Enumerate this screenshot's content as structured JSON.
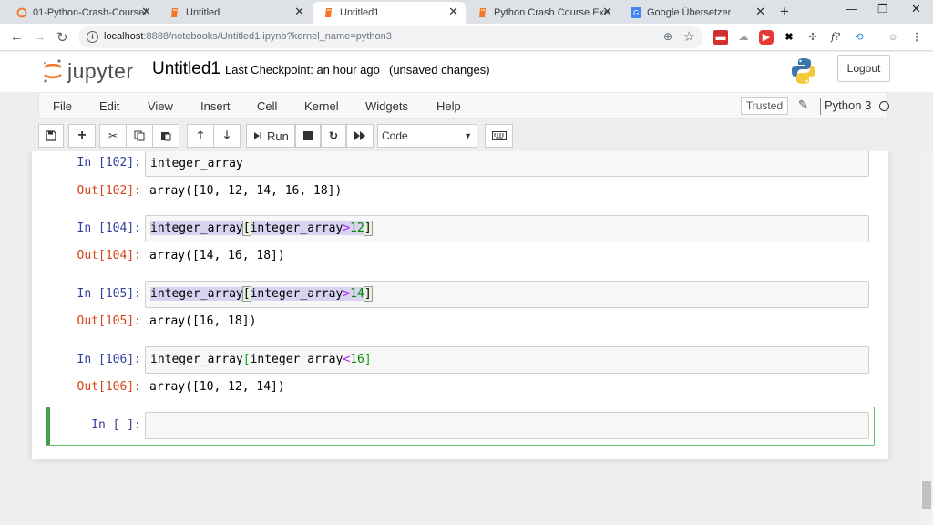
{
  "browser": {
    "tabs": [
      {
        "title": "01-Python-Crash-Course/",
        "icon": "jupyter-icon",
        "active": false
      },
      {
        "title": "Untitled",
        "icon": "notebook-icon",
        "active": false
      },
      {
        "title": "Untitled1",
        "icon": "notebook-icon",
        "active": true
      },
      {
        "title": "Python Crash Course Exerci",
        "icon": "notebook-icon",
        "active": false
      },
      {
        "title": "Google Übersetzer",
        "icon": "google-translate-icon",
        "active": false
      }
    ],
    "url_host": "localhost",
    "url_path": ":8888/notebooks/Untitled1.ipynb?kernel_name=python3",
    "window_controls": {
      "minimize": "—",
      "maximize": "❐",
      "close": "✕"
    }
  },
  "jupyter": {
    "logo_text": "jupyter",
    "notebook_name": "Untitled1",
    "checkpoint": "Last Checkpoint: an hour ago",
    "unsaved": "(unsaved changes)",
    "logout": "Logout",
    "menu": [
      "File",
      "Edit",
      "View",
      "Insert",
      "Cell",
      "Kernel",
      "Widgets",
      "Help"
    ],
    "trusted": "Trusted",
    "kernel": "Python 3",
    "run_label": "Run",
    "cell_type": "Code"
  },
  "cells": [
    {
      "in_prompt": "In [102]:",
      "code": "integer_array",
      "out_prompt": "Out[102]:",
      "output": "array([10, 12, 14, 16, 18])"
    },
    {
      "in_prompt": "In [104]:",
      "code_var": "integer_array",
      "code_inner": "integer_array",
      "code_op": ">",
      "code_num": "12",
      "out_prompt": "Out[104]:",
      "output": "array([14, 16, 18])"
    },
    {
      "in_prompt": "In [105]:",
      "code_var": "integer_array",
      "code_inner": "integer_array",
      "code_op": ">",
      "code_num": "14",
      "out_prompt": "Out[105]:",
      "output": "array([16, 18])"
    },
    {
      "in_prompt": "In [106]:",
      "code_var": "integer_array",
      "code_inner": "integer_array",
      "code_op": "<",
      "code_num": "16",
      "out_prompt": "Out[106]:",
      "output": "array([10, 12, 14])"
    },
    {
      "in_prompt": "In [ ]:"
    }
  ],
  "colors": {
    "in_prompt": "#303f9f",
    "out_prompt": "#d84315",
    "selected_cell": "#42a047"
  }
}
